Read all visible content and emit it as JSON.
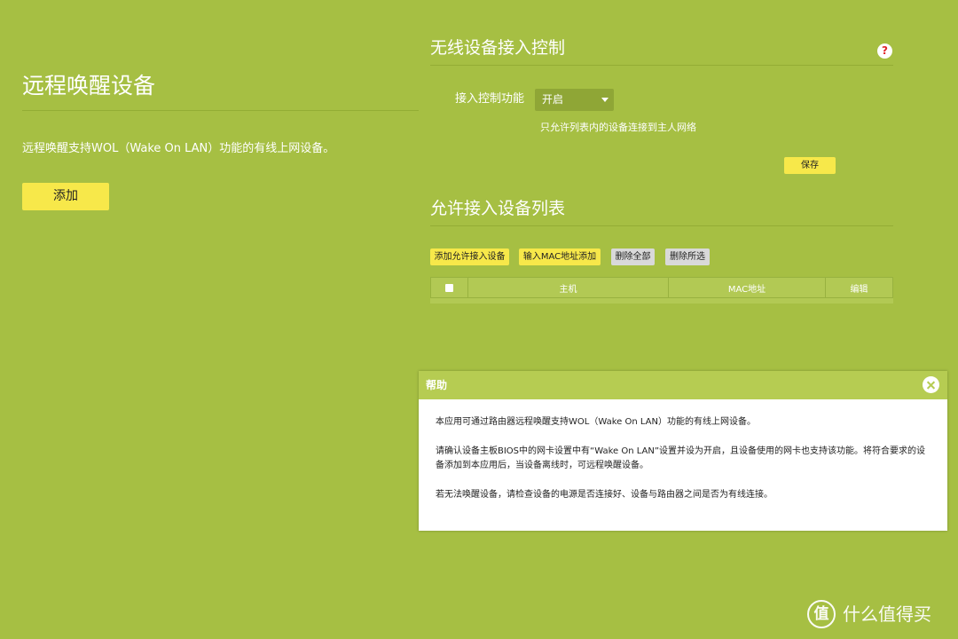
{
  "left_panel": {
    "title": "远程唤醒设备",
    "description": "远程唤醒支持WOL（Wake On LAN）功能的有线上网设备。",
    "add_button": "添加"
  },
  "access_control": {
    "title": "无线设备接入控制",
    "help_icon": "?",
    "label": "接入控制功能",
    "select_value": "开启",
    "hint": "只允许列表内的设备连接到主人网络",
    "save_button": "保存"
  },
  "allow_list": {
    "title": "允许接入设备列表",
    "buttons": {
      "add_device": "添加允许接入设备",
      "add_by_mac": "输入MAC地址添加",
      "delete_all": "删除全部",
      "delete_selected": "删除所选"
    },
    "columns": {
      "host": "主机",
      "mac": "MAC地址",
      "edit": "编辑"
    }
  },
  "help_dialog": {
    "title": "帮助",
    "paragraphs": [
      "本应用可通过路由器远程唤醒支持WOL（Wake On LAN）功能的有线上网设备。",
      "请确认设备主板BIOS中的网卡设置中有“Wake On LAN”设置并设为开启，且设备使用的网卡也支持该功能。将符合要求的设备添加到本应用后，当设备离线时，可远程唤醒设备。",
      "若无法唤醒设备，请检查设备的电源是否连接好、设备与路由器之间是否为有线连接。"
    ]
  },
  "watermark": {
    "logo": "值",
    "text": "什么值得买"
  },
  "colors": {
    "background": "#a6bf43",
    "button_yellow": "#f7e84a",
    "button_grey": "#d9d9d9",
    "help_header": "#b6cc52",
    "help_icon_red": "#e0262a"
  },
  "icons": {
    "help": "question-circle-icon",
    "close": "close-circle-icon",
    "dropdown": "chevron-down-icon"
  }
}
